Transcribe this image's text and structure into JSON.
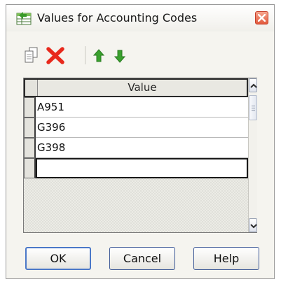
{
  "window": {
    "title": "Values for Accounting Codes",
    "close_icon": "close-icon",
    "app_icon": "grid-table-icon"
  },
  "toolbar": {
    "copy_icon": "copy-icon",
    "delete_icon": "delete-icon",
    "move_up_icon": "arrow-up-icon",
    "move_down_icon": "arrow-down-icon",
    "delete_color": "#e8291c",
    "arrow_color": "#3aa12e"
  },
  "grid": {
    "column_header": "Value",
    "rows": [
      "A951",
      "G396",
      "G398",
      ""
    ],
    "selected_row_index": 3
  },
  "buttons": {
    "ok": "OK",
    "cancel": "Cancel",
    "help": "Help"
  }
}
